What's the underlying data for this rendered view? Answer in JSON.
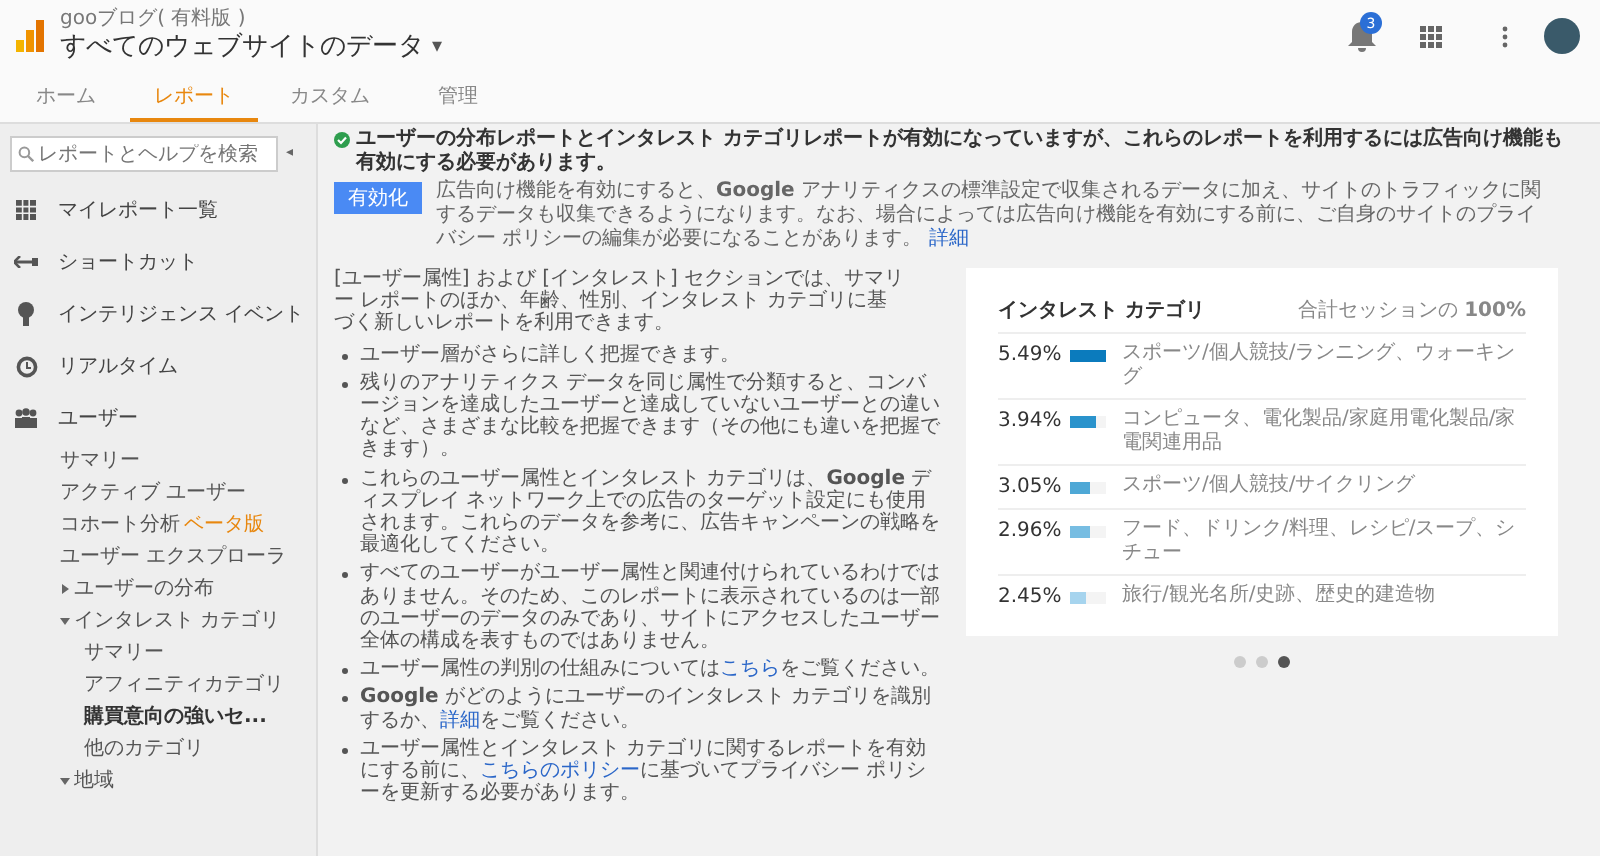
{
  "header": {
    "account": "gooブログ( 有料版 )",
    "property": "すべてのウェブサイトのデータ",
    "caret": "▾",
    "notification_count": "3"
  },
  "tabs": [
    {
      "label": "ホーム",
      "selected": false
    },
    {
      "label": "レポート",
      "selected": true
    },
    {
      "label": "カスタム",
      "selected": false
    },
    {
      "label": "管理",
      "selected": false
    }
  ],
  "sidebar": {
    "search": {
      "placeholder": "レポートとヘルプを検索"
    },
    "collapse": "◂",
    "items": [
      {
        "label": "マイレポート一覧"
      },
      {
        "label": "ショートカット"
      },
      {
        "label": "インテリジェンス イベント"
      },
      {
        "label": "リアルタイム"
      },
      {
        "label": "ユーザー",
        "children": [
          {
            "label": "サマリー",
            "selected": false
          },
          {
            "label": "アクティブ ユーザー",
            "selected": false
          },
          {
            "label": "コホート分析",
            "badge": "ベータ版",
            "selected": false
          },
          {
            "label": "ユーザー エクスプローラ",
            "selected": false
          },
          {
            "label": "ユーザーの分布",
            "expanded": false
          },
          {
            "label": "インタレスト カテゴリ",
            "expanded": true,
            "children": [
              {
                "label": "サマリー",
                "selected": false
              },
              {
                "label": "アフィニティカテゴリ",
                "selected": false
              },
              {
                "label": "購買意向の強いセ...",
                "selected": true
              },
              {
                "label": "他のカテゴリ",
                "selected": false
              }
            ]
          },
          {
            "label": "地域",
            "expanded": true
          }
        ]
      }
    ]
  },
  "notice": {
    "title": "ユーザーの分布レポートとインタレスト カテゴリレポートが有効になっていますが、これらのレポートを利用するには広告向け機能も有効にする必要があります。",
    "button": "有効化",
    "text": "広告向け機能を有効にすると、**Google** アナリティクスの標準設定で収集されるデータに加え、サイトのトラフィックに関するデータも収集できるようになります。なお、場合によっては広告向け機能を有効にする前に、ご自身のサイトのプライバシー ポリシーの編集が必要になることがあります。",
    "link": "詳細"
  },
  "intro": "[ユーザー属性] および [インタレスト] セクションでは、サマリー レポートのほか、年齢、性別、インタレスト カテゴリに基づく新しいレポートを利用できます。",
  "bullets": [
    [
      {
        "kind": "text",
        "text": "ユーザー層がさらに詳しく把握できます。"
      }
    ],
    [
      {
        "kind": "text",
        "text": "残りのアナリティクス データを同じ属性で分類すると、コンバージョンを達成したユーザーと達成していないユーザーとの違いなど、さまざまな比較を把握できます（その他にも違いを把握できます）。"
      }
    ],
    [
      {
        "kind": "text",
        "text": "これらのユーザー属性とインタレスト カテゴリは、**Google** ディスプレイ ネットワーク上での広告のターゲット設定にも使用されます。これらのデータを参考に、広告キャンペーンの戦略を最適化してください。"
      }
    ],
    [
      {
        "kind": "text",
        "text": "すべてのユーザーがユーザー属性と関連付けられているわけではありません。そのため、このレポートに表示されているのは一部のユーザーのデータのみであり、サイトにアクセスしたユーザー全体の構成を表すものではありません。"
      }
    ],
    [
      {
        "kind": "text",
        "text": "ユーザー属性の判別の仕組みについては"
      },
      {
        "kind": "link",
        "text": "こちら"
      },
      {
        "kind": "text",
        "text": "をご覧ください。"
      }
    ],
    [
      {
        "kind": "text",
        "text": "**Google** がどのようにユーザーのインタレスト カテゴリを識別するか、"
      },
      {
        "kind": "link",
        "text": "詳細"
      },
      {
        "kind": "text",
        "text": "をご覧ください。"
      }
    ],
    [
      {
        "kind": "text",
        "text": "ユーザー属性とインタレスト カテゴリに関するレポートを有効にする前に、"
      },
      {
        "kind": "link",
        "text": "こちらのポリシー"
      },
      {
        "kind": "text",
        "text": "に基づいてプライバシー ポリシーを更新する必要があります。"
      }
    ]
  ],
  "card": {
    "heading": "インタレスト カテゴリ",
    "total": "合計セッションの **100%**",
    "rows": [
      {
        "percent": "5.49%",
        "level": 1.0,
        "color": "#0b7bbd",
        "category": "スポーツ/個人競技/ランニング、ウォーキング"
      },
      {
        "percent": "3.94%",
        "level": 0.72,
        "color": "#2a93cc",
        "category": "コンピュータ、電化製品/家庭用電化製品/家電関連用品"
      },
      {
        "percent": "3.05%",
        "level": 0.56,
        "color": "#4ea8d6",
        "category": "スポーツ/個人競技/サイクリング"
      },
      {
        "percent": "2.96%",
        "level": 0.54,
        "color": "#77bde2",
        "category": "フード、ドリンク/料理、レシピ/スープ、シチュー"
      },
      {
        "percent": "2.45%",
        "level": 0.45,
        "color": "#a6d4ee",
        "category": "旅行/観光名所/史跡、歴史的建造物"
      }
    ]
  },
  "pager": [
    {
      "selected": false
    },
    {
      "selected": false
    },
    {
      "selected": true
    }
  ]
}
